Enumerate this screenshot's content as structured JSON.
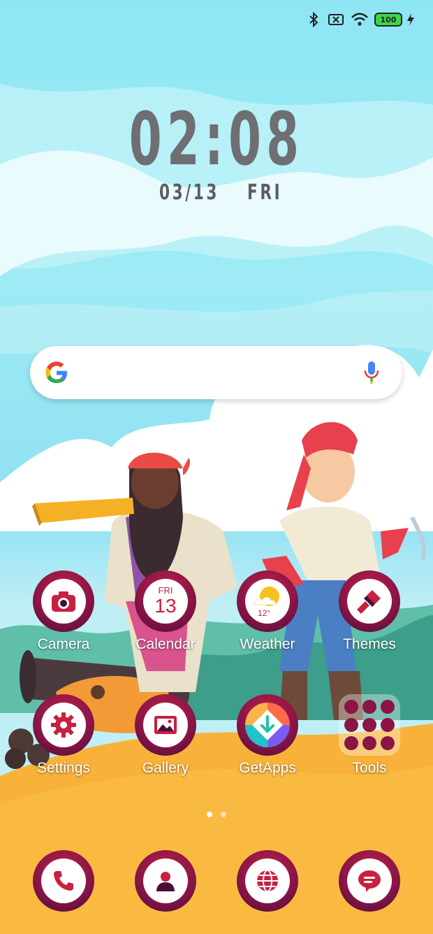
{
  "status_bar": {
    "battery_level": "100",
    "icons": [
      "bluetooth-icon",
      "sim-off-icon",
      "wifi-icon",
      "battery-icon",
      "charging-icon"
    ]
  },
  "clock": {
    "time": "02:08",
    "date": "03/13",
    "weekday": "FRI"
  },
  "search": {
    "icons": [
      "google-logo",
      "mic-icon"
    ]
  },
  "apps_row1": [
    {
      "label": "Camera",
      "icon": "camera-icon"
    },
    {
      "label": "Calendar",
      "icon": "calendar-icon",
      "day_name": "FRI",
      "day_number": "13"
    },
    {
      "label": "Weather",
      "icon": "weather-icon",
      "temp": "12°"
    },
    {
      "label": "Themes",
      "icon": "paintbrush-icon"
    }
  ],
  "apps_row2": [
    {
      "label": "Settings",
      "icon": "gear-icon"
    },
    {
      "label": "Gallery",
      "icon": "gallery-icon"
    },
    {
      "label": "GetApps",
      "icon": "getapps-icon"
    },
    {
      "label": "Tools",
      "icon": "folder-icon"
    }
  ],
  "page_indicator": {
    "count": 2,
    "active": 0
  },
  "dock": [
    {
      "icon": "phone-icon"
    },
    {
      "icon": "contacts-icon"
    },
    {
      "icon": "browser-icon"
    },
    {
      "icon": "messages-icon"
    }
  ],
  "colors": {
    "icon_ring_dark": "#4a0d3a",
    "icon_ring_mid": "#8a1546",
    "icon_ring_light": "#c42049",
    "sky": "#8ee6f4",
    "sand": "#f8b23a"
  }
}
